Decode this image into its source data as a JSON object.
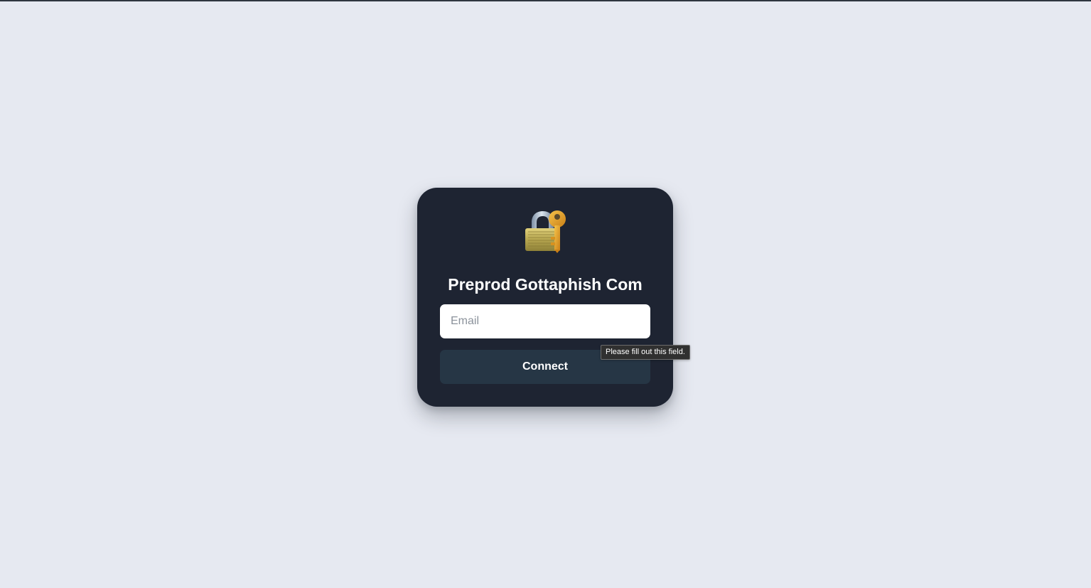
{
  "login": {
    "title": "Preprod Gottaphish Com",
    "icon": "locked-with-key-icon",
    "email": {
      "value": "",
      "placeholder": "Email"
    },
    "connect_label": "Connect",
    "validation_message": "Please fill out this field."
  },
  "colors": {
    "background": "#e6e9f1",
    "card": "#1e2432",
    "button": "#263645",
    "input": "#ffffff",
    "text": "#ffffff"
  }
}
